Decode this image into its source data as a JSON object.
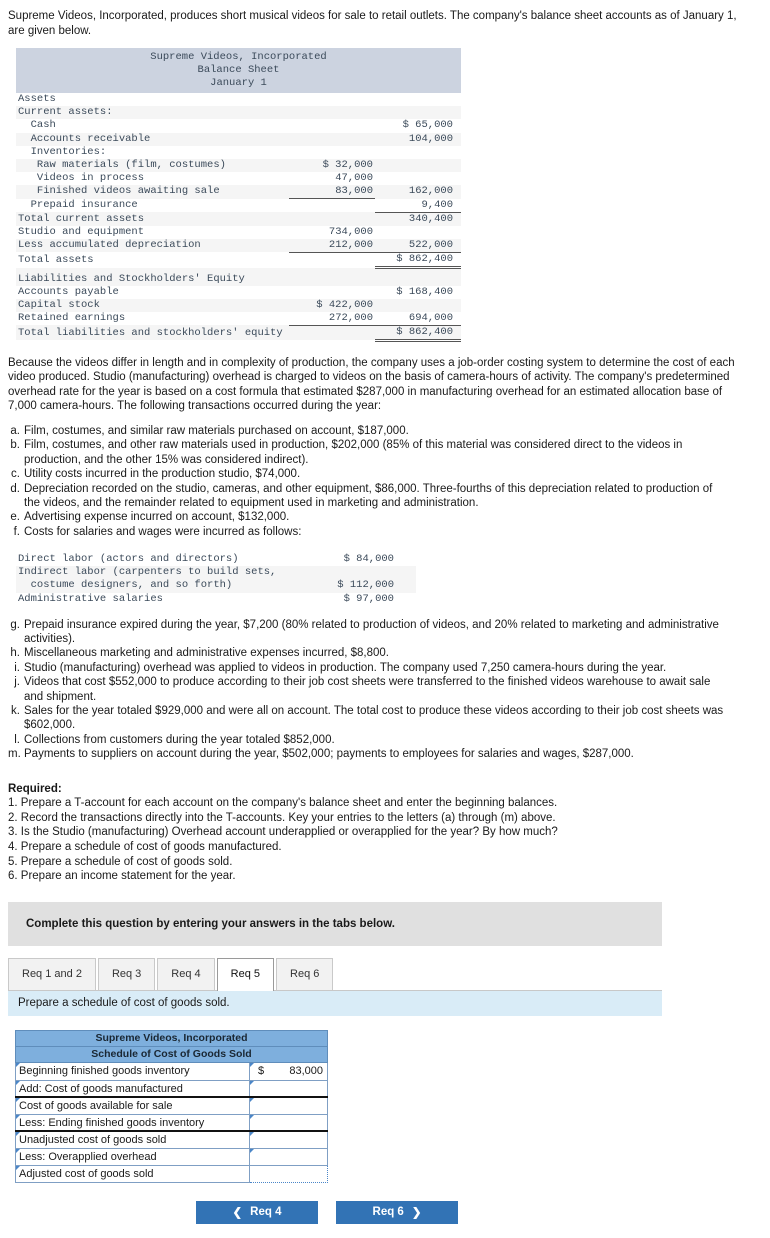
{
  "intro": "Supreme Videos, Incorporated, produces short musical videos for sale to retail outlets. The company's balance sheet accounts as of January 1, are given below.",
  "balance_sheet": {
    "title_line1": "Supreme Videos, Incorporated",
    "title_line2": "Balance Sheet",
    "title_line3": "January 1",
    "rows": [
      {
        "label": "Assets",
        "c1": "",
        "c2": ""
      },
      {
        "label": "Current assets:",
        "c1": "",
        "c2": ""
      },
      {
        "label": "  Cash",
        "c1": "",
        "c2": "$ 65,000"
      },
      {
        "label": "  Accounts receivable",
        "c1": "",
        "c2": "104,000"
      },
      {
        "label": "  Inventories:",
        "c1": "",
        "c2": ""
      },
      {
        "label": "   Raw materials (film, costumes)",
        "c1": "$ 32,000",
        "c2": ""
      },
      {
        "label": "   Videos in process",
        "c1": "47,000",
        "c2": ""
      },
      {
        "label": "   Finished videos awaiting sale",
        "c1": "83,000",
        "c2": "162,000"
      },
      {
        "label": "  Prepaid insurance",
        "c1": "",
        "c2": "9,400"
      },
      {
        "label": "Total current assets",
        "c1": "",
        "c2": "340,400"
      },
      {
        "label": "Studio and equipment",
        "c1": "734,000",
        "c2": ""
      },
      {
        "label": "Less accumulated depreciation",
        "c1": "212,000",
        "c2": "522,000"
      },
      {
        "label": "Total assets",
        "c1": "",
        "c2": "$ 862,400"
      },
      {
        "label": "Liabilities and Stockholders' Equity",
        "c1": "",
        "c2": ""
      },
      {
        "label": "Accounts payable",
        "c1": "",
        "c2": "$ 168,400"
      },
      {
        "label": "Capital stock",
        "c1": "$ 422,000",
        "c2": ""
      },
      {
        "label": "Retained earnings",
        "c1": "272,000",
        "c2": "694,000"
      },
      {
        "label": "Total liabilities and stockholders' equity",
        "c1": "",
        "c2": "$ 862,400"
      }
    ]
  },
  "paragraph": "Because the videos differ in length and in complexity of production, the company uses a job-order costing system to determine the cost of each video produced. Studio (manufacturing) overhead is charged to videos on the basis of camera-hours of activity. The company's predetermined overhead rate for the year is based on a cost formula that estimated $287,000 in manufacturing overhead for an estimated allocation base of 7,000 camera-hours. The following transactions occurred during the year:",
  "transactions_top": [
    {
      "mark": "a.",
      "text": "Film, costumes, and similar raw materials purchased on account, $187,000."
    },
    {
      "mark": "b.",
      "text": "Film, costumes, and other raw materials used in production, $202,000 (85% of this material was considered direct to the videos in production, and the other 15% was considered indirect)."
    },
    {
      "mark": "c.",
      "text": "Utility costs incurred in the production studio, $74,000."
    },
    {
      "mark": "d.",
      "text": "Depreciation recorded on the studio, cameras, and other equipment, $86,000. Three-fourths of this depreciation related to production of the videos, and the remainder related to equipment used in marketing and administration."
    },
    {
      "mark": "e.",
      "text": "Advertising expense incurred on account, $132,000."
    },
    {
      "mark": "f.",
      "text": "Costs for salaries and wages were incurred as follows:"
    }
  ],
  "salary_table": {
    "rows": [
      {
        "label": "Direct labor (actors and directors)",
        "label2": "",
        "amount": "$ 84,000"
      },
      {
        "label": "Indirect labor (carpenters to build sets,",
        "label2": "  costume designers, and so forth)",
        "amount": "$ 112,000"
      },
      {
        "label": "Administrative salaries",
        "label2": "",
        "amount": "$ 97,000"
      }
    ]
  },
  "transactions_bottom": [
    {
      "mark": "g.",
      "text": "Prepaid insurance expired during the year, $7,200 (80% related to production of videos, and 20% related to marketing and administrative activities)."
    },
    {
      "mark": "h.",
      "text": "Miscellaneous marketing and administrative expenses incurred, $8,800."
    },
    {
      "mark": "i.",
      "text": "Studio (manufacturing) overhead was applied to videos in production. The company used 7,250 camera-hours during the year."
    },
    {
      "mark": "j.",
      "text": "Videos that cost $552,000 to produce according to their job cost sheets were transferred to the finished videos warehouse to await sale and shipment."
    },
    {
      "mark": "k.",
      "text": "Sales for the year totaled $929,000 and were all on account. The total cost to produce these videos according to their job cost sheets was $602,000."
    },
    {
      "mark": "l.",
      "text": "Collections from customers during the year totaled $852,000."
    },
    {
      "mark": "m.",
      "text": "Payments to suppliers on account during the year, $502,000; payments to employees for salaries and wages, $287,000."
    }
  ],
  "required": {
    "heading": "Required:",
    "items": [
      "1. Prepare a T-account for each account on the company's balance sheet and enter the beginning balances.",
      "2. Record the transactions directly into the T-accounts. Key your entries to the letters (a) through (m) above.",
      "3. Is the Studio (manufacturing) Overhead account underapplied or overapplied for the year? By how much?",
      "4. Prepare a schedule of cost of goods manufactured.",
      "5. Prepare a schedule of cost of goods sold.",
      "6. Prepare an income statement for the year."
    ]
  },
  "banner": "Complete this question by entering your answers in the tabs below.",
  "tabs": [
    {
      "label": "Req 1 and 2",
      "active": false
    },
    {
      "label": "Req 3",
      "active": false
    },
    {
      "label": "Req 4",
      "active": false
    },
    {
      "label": "Req 5",
      "active": true
    },
    {
      "label": "Req 6",
      "active": false
    }
  ],
  "subbanner": "Prepare a schedule of cost of goods sold.",
  "answer_sheet": {
    "title_line1": "Supreme Videos, Incorporated",
    "title_line2": "Schedule of Cost of Goods Sold",
    "rows": [
      {
        "label": "Beginning finished goods inventory",
        "currency": "$",
        "amount": "83,000",
        "rule": "none"
      },
      {
        "label": "Add: Cost of goods manufactured",
        "currency": "",
        "amount": "",
        "rule": "line"
      },
      {
        "label": "Cost of goods available for sale",
        "currency": "",
        "amount": "",
        "rule": "none"
      },
      {
        "label": "Less: Ending finished goods inventory",
        "currency": "",
        "amount": "",
        "rule": "line"
      },
      {
        "label": "Unadjusted cost of goods sold",
        "currency": "",
        "amount": "",
        "rule": "none"
      },
      {
        "label": "Less: Overapplied overhead",
        "currency": "",
        "amount": "",
        "rule": "none"
      },
      {
        "label": "Adjusted cost of goods sold",
        "currency": "",
        "amount": "",
        "rule": "dotted"
      }
    ]
  },
  "nav": {
    "prev_label": "Req 4",
    "next_label": "Req 6",
    "prev_icon": "chevron-left-icon",
    "next_icon": "chevron-right-icon"
  },
  "colors": {
    "accent": "#3273b5",
    "table_header": "#7eafdd",
    "banner": "#e0e0e0",
    "subbanner": "#d9ecf7",
    "bs_header": "#ccd3e0"
  }
}
